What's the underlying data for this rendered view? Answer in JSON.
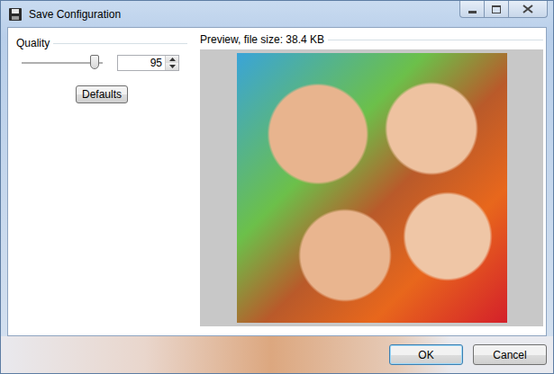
{
  "window": {
    "title": "Save Configuration"
  },
  "quality": {
    "label": "Quality",
    "level": 0.95,
    "value": "95",
    "defaults_button": "Defaults"
  },
  "preview": {
    "label": "Preview, file size: 38.4 KB"
  },
  "buttons": [
    {
      "label": "OK",
      "default": true
    },
    {
      "label": "Cancel",
      "default": false
    }
  ]
}
